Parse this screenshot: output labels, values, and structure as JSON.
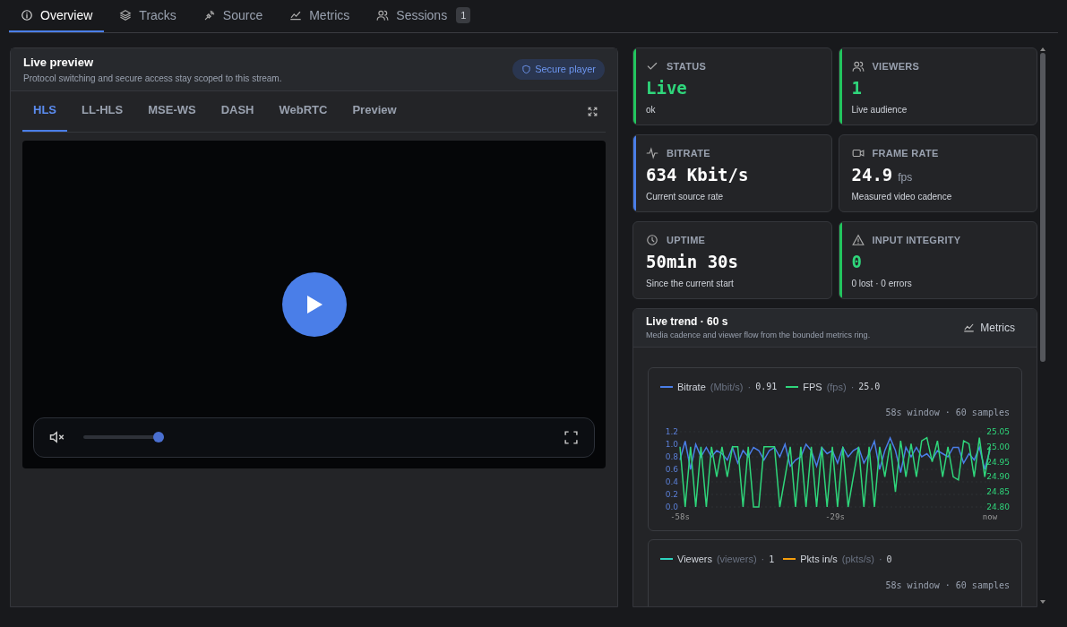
{
  "tabs": [
    {
      "label": "Overview",
      "selected": true
    },
    {
      "label": "Tracks",
      "selected": false
    },
    {
      "label": "Source",
      "selected": false
    },
    {
      "label": "Metrics",
      "selected": false
    },
    {
      "label": "Sessions",
      "selected": false,
      "badge": "1"
    }
  ],
  "preview": {
    "title": "Live preview",
    "subtitle": "Protocol switching and secure access stay scoped to this stream.",
    "badge": "Secure player",
    "protocols": [
      {
        "label": "HLS",
        "selected": true
      },
      {
        "label": "LL-HLS",
        "selected": false
      },
      {
        "label": "MSE-WS",
        "selected": false
      },
      {
        "label": "DASH",
        "selected": false
      },
      {
        "label": "WebRTC",
        "selected": false
      },
      {
        "label": "Preview",
        "selected": false
      }
    ],
    "player": {
      "muted": true,
      "volume": {
        "level": 1
      }
    }
  },
  "stats": [
    {
      "label": "STATUS",
      "value": "Live",
      "note": "ok",
      "highlight": true,
      "color": "#22c55e"
    },
    {
      "label": "VIEWERS",
      "value": "1",
      "note": "Live audience",
      "highlight": true,
      "color": "#22c55e"
    },
    {
      "label": "BITRATE",
      "value": "634 Kbit/s",
      "note": "Current source rate",
      "highlight": false,
      "color": "#4a7ee8"
    },
    {
      "label": "FRAME RATE",
      "value": "24.9",
      "unit": "fps",
      "note": "Measured video cadence",
      "highlight": false
    },
    {
      "label": "UPTIME",
      "value": "50min 30s",
      "note": "Since the current start",
      "highlight": false
    },
    {
      "label": "INPUT INTEGRITY",
      "value": "0",
      "note": "0 lost · 0 errors",
      "highlight": true,
      "color": "#22c55e"
    }
  ],
  "trend": {
    "title": "Live trend · 60 s",
    "subtitle": "Media cadence and viewer flow from the bounded metrics ring.",
    "button": "Metrics",
    "charts": [
      {
        "legend": [
          {
            "unit": "(Mbit/s)",
            "separator": "·",
            "value": "0.91"
          },
          {
            "unit": "(fps)",
            "separator": "·",
            "value": "25.0"
          }
        ],
        "window": "58s window · 60 samples",
        "chart_data": {
          "type": "line",
          "grid": true,
          "x": [
            -58,
            -57.02,
            -56.03,
            -55.05,
            -54.07,
            -53.08,
            -52.1,
            -51.12,
            -50.14,
            -49.15,
            -48.17,
            -47.19,
            -46.2,
            -45.22,
            -44.24,
            -43.25,
            -42.27,
            -41.29,
            -40.31,
            -39.32,
            -38.34,
            -37.36,
            -36.37,
            -35.39,
            -34.41,
            -33.42,
            -32.44,
            -31.46,
            -30.47,
            -29.49,
            -28.51,
            -27.53,
            -26.54,
            -25.56,
            -24.58,
            -23.59,
            -22.61,
            -21.63,
            -20.64,
            -19.66,
            -18.68,
            -17.69,
            -16.71,
            -15.73,
            -14.75,
            -13.76,
            -12.78,
            -11.8,
            -10.81,
            -9.83,
            -8.85,
            -7.86,
            -6.88,
            -5.9,
            -4.92,
            -3.93,
            -2.95,
            -1.97,
            -0.98,
            0
          ],
          "xlim": [
            -58,
            0
          ],
          "xticks": [
            {
              "value": -58,
              "label": "-58s"
            },
            {
              "value": -29,
              "label": "-29s"
            },
            {
              "value": 0,
              "label": "now"
            }
          ],
          "ylim": [
            0,
            1.2
          ],
          "yticks": [
            {
              "value": 0,
              "label": "0.0"
            },
            0.2,
            0.4,
            0.6,
            0.8,
            {
              "value": 1,
              "label": "1.0"
            },
            1.2
          ],
          "y2lim": [
            24.8,
            25.05
          ],
          "y2ticks": [
            {
              "value": 24.8,
              "label": "24.80"
            },
            24.85,
            {
              "value": 24.9,
              "label": "24.90"
            },
            24.95,
            {
              "value": 25,
              "label": "25.00"
            },
            25.05
          ],
          "series": [
            {
              "name": "Bitrate",
              "color": "#4a7ee8",
              "values": [
                0.75,
                1.05,
                0.6,
                1.0,
                0.8,
                0.95,
                0.8,
                0.9,
                0.85,
                0.75,
                0.95,
                0.7,
                0.9,
                0.8,
                0.95,
                0.9,
                0.75,
                0.9,
                0.95,
                0.8,
                1.0,
                0.65,
                0.75,
                0.8,
                1.0,
                0.9,
                0.65,
                0.95,
                0.85,
                0.9,
                0.7,
                0.95,
                0.8,
                0.9,
                0.95,
                0.7,
                0.85,
                1.05,
                0.6,
                0.9,
                1.1,
                0.9,
                0.55,
                0.95,
                0.8,
                0.95,
                0.8,
                0.85,
                0.75,
                0.9,
                0.85,
                0.8,
                0.95,
                0.95,
                0.7,
                0.85,
                0.75,
                0.95,
                0.6,
                0.91
              ]
            },
            {
              "name": "FPS",
              "color": "#2fd67b",
              "axis": "y2",
              "values": [
                25.0,
                24.8,
                25.0,
                24.8,
                25.0,
                24.8,
                25.0,
                24.9,
                25.0,
                24.9,
                25.0,
                25.0,
                24.8,
                25.0,
                24.8,
                24.8,
                25.0,
                25.0,
                25.0,
                24.8,
                24.9,
                25.0,
                24.8,
                25.0,
                24.8,
                25.0,
                24.8,
                25.0,
                24.8,
                25.0,
                24.8,
                25.0,
                24.8,
                24.9,
                25.0,
                24.8,
                25.0,
                24.8,
                25.0,
                24.9,
                25.01,
                24.85,
                25.02,
                24.9,
                25.01,
                24.9,
                25.02,
                25.03,
                24.95,
                25.02,
                24.9,
                25.0,
                24.9,
                24.89,
                25.02,
                25.01,
                24.9,
                25.03,
                24.9,
                25.0
              ]
            }
          ]
        }
      },
      {
        "legend": [
          {
            "name": "Viewers",
            "unit": "(viewers)",
            "separator": "·",
            "value": "1",
            "color": "#2dd4bf"
          },
          {
            "name": "Pkts in/s",
            "unit": "(pkts/s)",
            "separator": "·",
            "value": "0",
            "color": "#f59e0b"
          }
        ],
        "window": "58s window · 60 samples"
      }
    ]
  }
}
